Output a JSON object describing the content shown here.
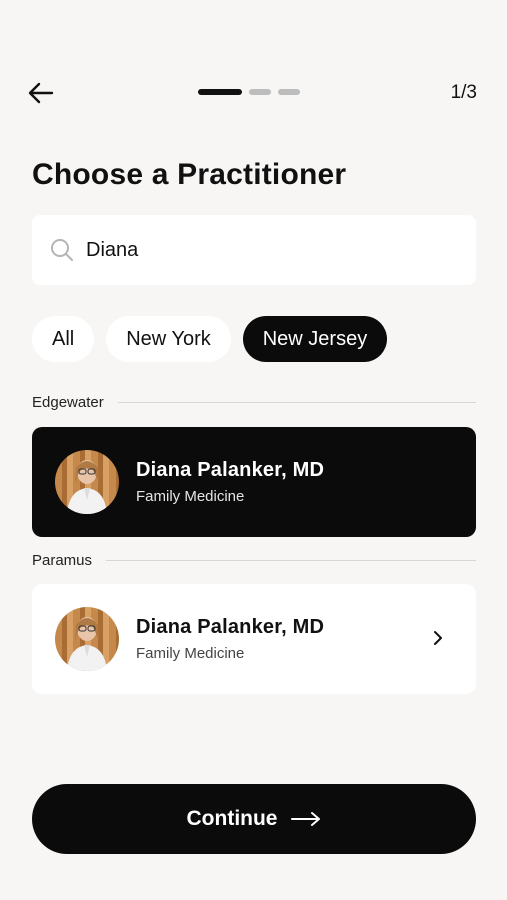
{
  "header": {
    "step_indicator": "1/3",
    "progress": {
      "current_step": 1,
      "total_steps": 3
    }
  },
  "page_title": "Choose a Practitioner",
  "search": {
    "value": "Diana",
    "placeholder": ""
  },
  "filters": {
    "items": [
      {
        "label": "All",
        "selected": false
      },
      {
        "label": "New York",
        "selected": false
      },
      {
        "label": "New Jersey",
        "selected": true
      }
    ]
  },
  "sections": [
    {
      "location": "Edgewater",
      "practitioners": [
        {
          "name": "Diana Palanker, MD",
          "specialty": "Family Medicine",
          "selected": true
        }
      ]
    },
    {
      "location": "Paramus",
      "practitioners": [
        {
          "name": "Diana Palanker, MD",
          "specialty": "Family Medicine",
          "selected": false
        }
      ]
    }
  ],
  "footer": {
    "continue_label": "Continue"
  },
  "colors": {
    "background": "#f7f6f4",
    "primary": "#0b0b0b",
    "surface": "#ffffff"
  },
  "icons": [
    "arrow-left-icon",
    "search-icon",
    "chevron-right-icon",
    "arrow-right-icon"
  ]
}
